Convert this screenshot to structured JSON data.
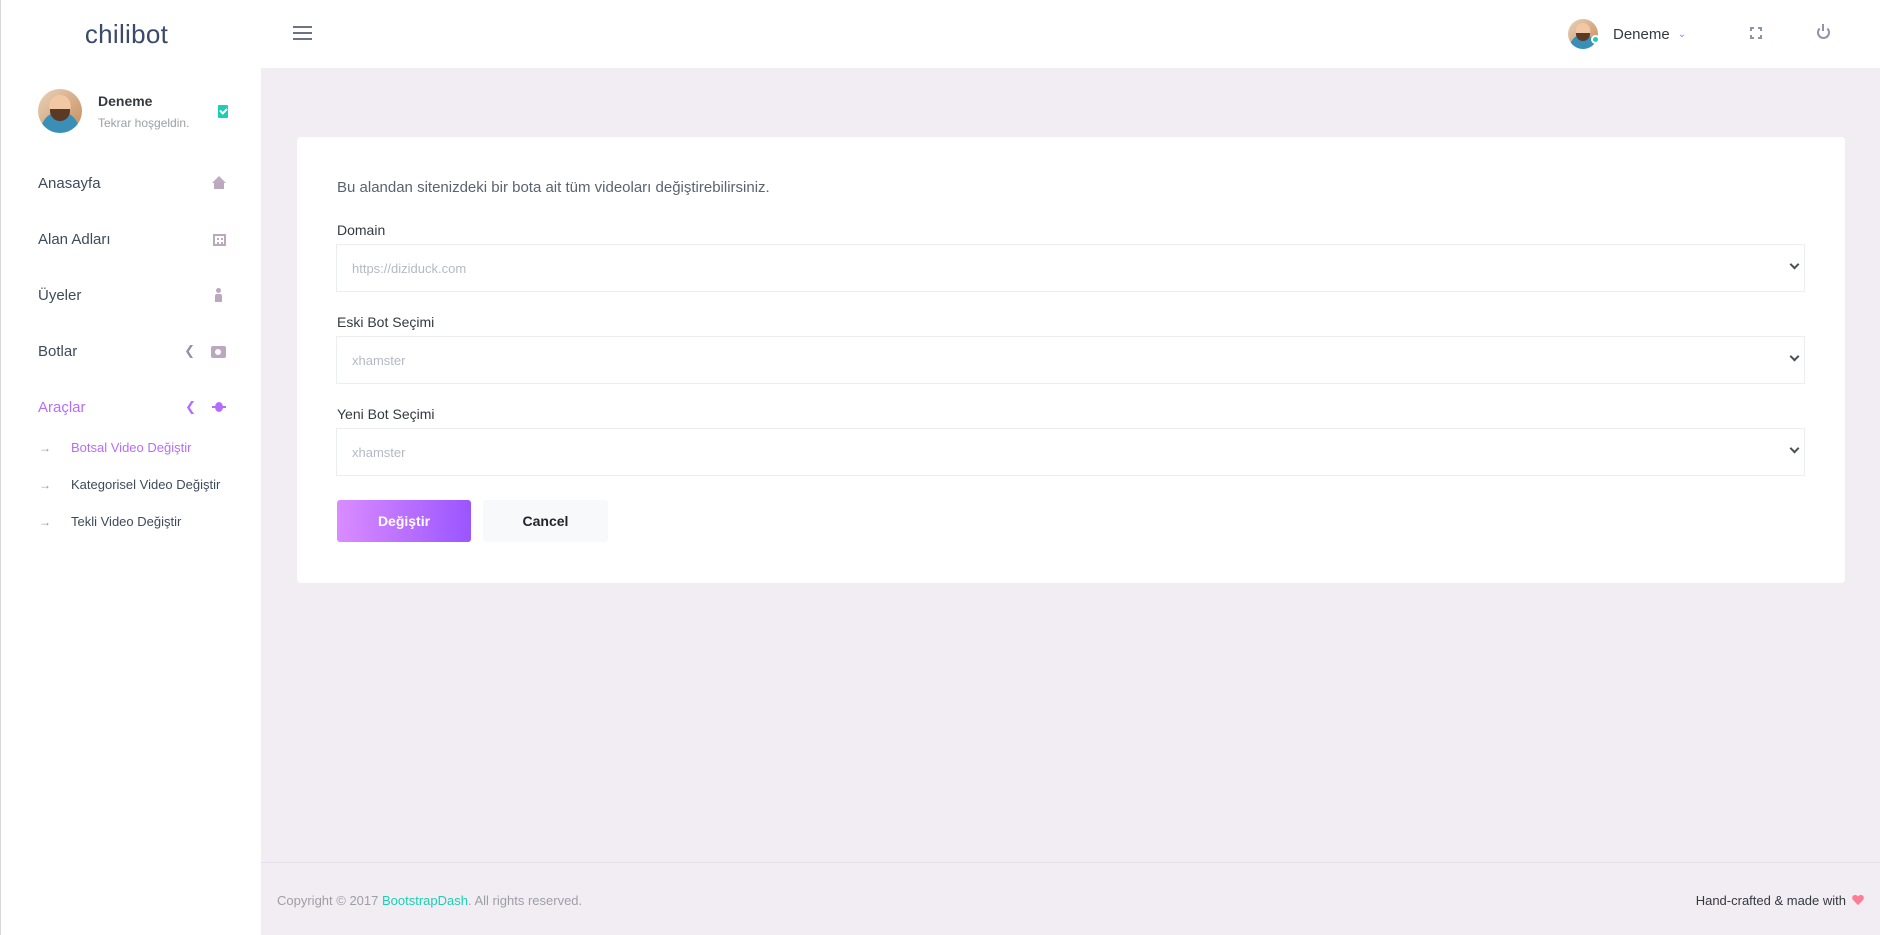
{
  "brand": {
    "name": "chilibot"
  },
  "profile": {
    "name": "Deneme",
    "subtitle": "Tekrar hoşgeldin."
  },
  "sidebar": {
    "items": [
      {
        "label": "Anasayfa",
        "icon": "house-icon"
      },
      {
        "label": "Alan Adları",
        "icon": "building-icon"
      },
      {
        "label": "Üyeler",
        "icon": "person-icon"
      },
      {
        "label": "Botlar",
        "icon": "chat-icon"
      },
      {
        "label": "Araçlar",
        "icon": "bug-icon"
      }
    ],
    "subitems": [
      {
        "label": "Botsal Video Değiştir"
      },
      {
        "label": "Kategorisel Video Değiştir"
      },
      {
        "label": "Tekli Video Değiştir"
      }
    ]
  },
  "topbar": {
    "user_name": "Deneme"
  },
  "form": {
    "description": "Bu alandan sitenizdeki bir bota ait tüm videoları değiştirebilirsiniz.",
    "domain_label": "Domain",
    "domain_value": "https://diziduck.com",
    "old_bot_label": "Eski Bot Seçimi",
    "old_bot_value": "xhamster",
    "new_bot_label": "Yeni Bot Seçimi",
    "new_bot_value": "xhamster",
    "submit_label": "Değiştir",
    "cancel_label": "Cancel"
  },
  "footer": {
    "copyright_prefix": "Copyright © 2017 ",
    "copyright_link": "BootstrapDash",
    "copyright_suffix": ". All rights reserved.",
    "right_text": "Hand-crafted & made with"
  },
  "colors": {
    "accent": "#b66dff",
    "teal": "#1bcfb4",
    "heart": "#fe7c96",
    "background": "#f2edf3"
  }
}
